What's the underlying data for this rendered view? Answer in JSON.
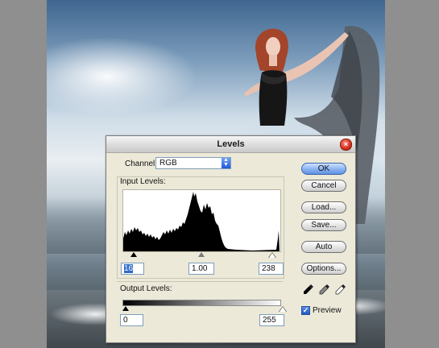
{
  "dialog": {
    "title": "Levels",
    "channel_label": "Channel:",
    "channel_value": "RGB",
    "input_levels_label": "Input Levels:",
    "output_levels_label": "Output Levels:",
    "input_black": "16",
    "input_gamma": "1.00",
    "input_white": "238",
    "output_black": "0",
    "output_white": "255",
    "preview_label": "Preview",
    "preview_checked": true
  },
  "buttons": {
    "ok": "OK",
    "cancel": "Cancel",
    "load": "Load...",
    "save": "Save...",
    "auto": "Auto",
    "options": "Options..."
  },
  "icons": {
    "close": "close-icon",
    "dropdown": "updown-arrows-icon",
    "black_eyedropper": "black-eyedropper-icon",
    "gray_eyedropper": "gray-eyedropper-icon",
    "white_eyedropper": "white-eyedropper-icon",
    "checkmark": "checkmark-icon"
  },
  "colors": {
    "ok_button": "#6f9be6",
    "close_button": "#d12a18",
    "dialog_bg": "#ece9d8"
  }
}
